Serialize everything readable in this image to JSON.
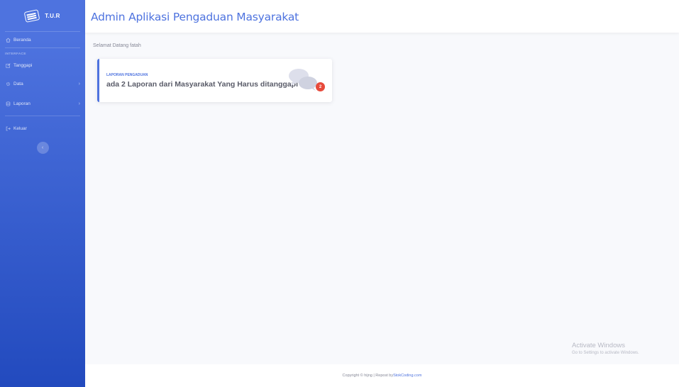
{
  "brand": {
    "name": "T.U.R",
    "icon": "keyboard-icon"
  },
  "sidebar": {
    "items": [
      {
        "label": "Beranda",
        "icon": "home-icon"
      },
      {
        "heading": "INTERFACE"
      },
      {
        "label": "Tanggapi",
        "icon": "edit-icon"
      },
      {
        "label": "Data",
        "icon": "gear-icon",
        "chevron": "›"
      },
      {
        "label": "Laporan",
        "icon": "database-icon",
        "chevron": "›"
      },
      {
        "label": "Keluar",
        "icon": "logout-icon"
      }
    ],
    "toggle_icon": "‹"
  },
  "topbar": {
    "title": "Admin Aplikasi Pengaduan Masyarakat"
  },
  "main": {
    "greeting": "Selamat Datang fatah",
    "card": {
      "label": "LAPORAN PENGADUAN",
      "value": "ada 2 Laporan dari Masyarakat Yang Harus ditanggapi",
      "badge": "2",
      "icon": "comments-icon"
    }
  },
  "watermark": {
    "title": "Activate Windows",
    "subtitle": "Go to Settings to activate Windows."
  },
  "footer": {
    "text": "Copyright © hijng | Repost by ",
    "link": "StokCoding.com"
  },
  "colors": {
    "primary": "#4e73df",
    "danger": "#e74a3b",
    "text": "#5a5c69",
    "muted": "#858796"
  }
}
